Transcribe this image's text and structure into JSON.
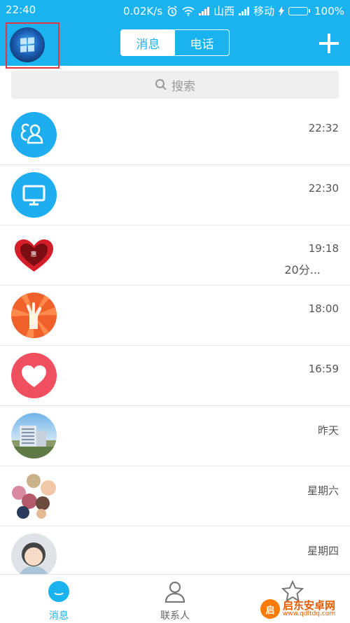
{
  "status_bar": {
    "time": "22:40",
    "speed": "0.02K/s",
    "carrier1": "山西",
    "carrier2": "移动",
    "battery": "100%"
  },
  "header": {
    "tabs": [
      {
        "label": "消息",
        "active": true
      },
      {
        "label": "电话",
        "active": false
      }
    ],
    "add_icon": "plus-icon"
  },
  "search": {
    "placeholder": "搜索",
    "icon": "search-icon"
  },
  "conversations": [
    {
      "avatar": "group-icon",
      "time": "22:32",
      "preview": ""
    },
    {
      "avatar": "monitor-icon",
      "time": "22:30",
      "preview": ""
    },
    {
      "avatar": "heart-badge",
      "time": "19:18",
      "preview": "20分..."
    },
    {
      "avatar": "hand-icon",
      "time": "18:00",
      "preview": ""
    },
    {
      "avatar": "heart-icon",
      "time": "16:59",
      "preview": ""
    },
    {
      "avatar": "building-photo",
      "time": "昨天",
      "preview": ""
    },
    {
      "avatar": "group-collage",
      "time": "星期六",
      "preview": ""
    },
    {
      "avatar": "person-avatar",
      "time": "星期四",
      "preview": ""
    }
  ],
  "bottom_nav": [
    {
      "label": "消息",
      "icon": "chat-bubble-icon",
      "active": true
    },
    {
      "label": "联系人",
      "icon": "contact-icon",
      "active": false
    },
    {
      "label": "动态",
      "icon": "star-icon",
      "active": false
    }
  ],
  "watermark": {
    "title": "启东安卓网",
    "url": "www.qdltdq.com"
  },
  "colors": {
    "accent": "#1ab3f0",
    "highlight_border": "#e3373b"
  }
}
